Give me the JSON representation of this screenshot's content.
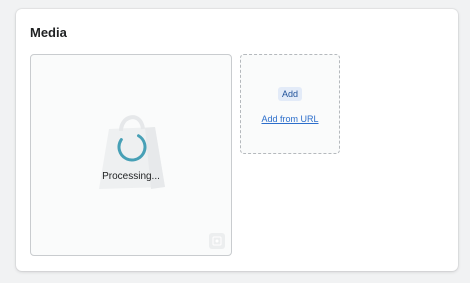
{
  "card": {
    "title": "Media"
  },
  "media_item": {
    "status_text": "Processing...",
    "placeholder_icon": "shopping-bag-icon",
    "spinner_icon": "spinner-icon",
    "select_icon": "image-icon"
  },
  "dropzone": {
    "add_label": "Add",
    "add_from_url_label": "Add from URL"
  },
  "colors": {
    "accent": "#2c6ecb",
    "spinner": "#47a0b6",
    "card_bg": "#ffffff",
    "page_bg": "#f1f2f3"
  }
}
